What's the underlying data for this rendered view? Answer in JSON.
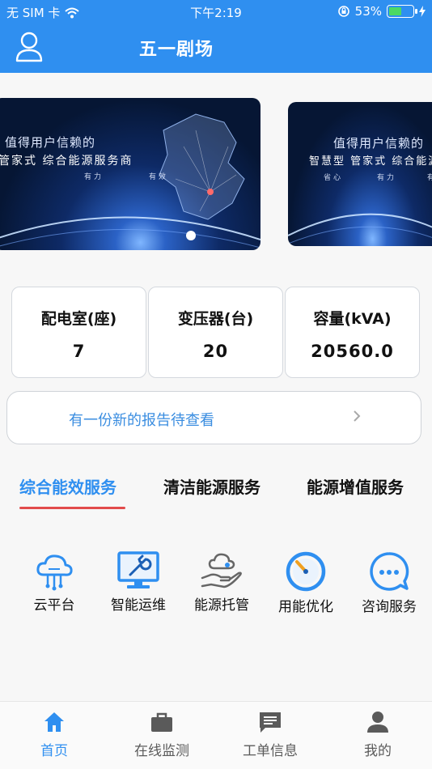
{
  "status_bar": {
    "carrier": "无 SIM 卡",
    "time": "下午2:19",
    "battery_percent": "53%",
    "battery_level": 0.53
  },
  "header": {
    "title": "五一剧场"
  },
  "banners": [
    {
      "line1": "值得用户信赖的",
      "line2": "管家式 综合能源服务商",
      "tag1": "有力",
      "tag2": "有效"
    },
    {
      "line1": "值得用户信赖的",
      "line2": "智慧型 管家式 综合能源服",
      "tag1": "省心",
      "tag2": "有力",
      "tag3": "有效"
    }
  ],
  "stats": [
    {
      "label": "配电室(座)",
      "value": "7"
    },
    {
      "label": "变压器(台)",
      "value": "20"
    },
    {
      "label": "容量(kVA)",
      "value": "20560.0"
    }
  ],
  "notice": {
    "text": "有一份新的报告待查看"
  },
  "tabs": [
    {
      "label": "综合能效服务",
      "active": true
    },
    {
      "label": "清洁能源服务",
      "active": false
    },
    {
      "label": "能源增值服务",
      "active": false
    }
  ],
  "services": [
    {
      "name": "云平台",
      "icon": "cloud-platform-icon"
    },
    {
      "name": "智能运维",
      "icon": "monitor-wrench-icon"
    },
    {
      "name": "能源托管",
      "icon": "hand-cloud-icon"
    },
    {
      "name": "用能优化",
      "icon": "gauge-icon"
    },
    {
      "name": "咨询服务",
      "icon": "chat-bubble-icon"
    }
  ],
  "tabbar": [
    {
      "label": "首页",
      "icon": "home-icon",
      "active": true
    },
    {
      "label": "在线监测",
      "icon": "briefcase-icon",
      "active": false
    },
    {
      "label": "工单信息",
      "icon": "message-icon",
      "active": false
    },
    {
      "label": "我的",
      "icon": "person-icon",
      "active": false
    }
  ],
  "colors": {
    "primary": "#2f8ff0",
    "tab_underline": "#e24b4b",
    "notice_text": "#3a8de0"
  }
}
